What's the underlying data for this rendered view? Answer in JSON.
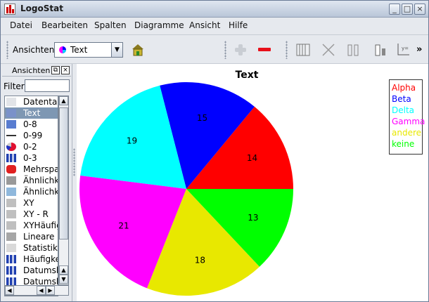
{
  "window": {
    "title": "LogoStat"
  },
  "menubar": [
    "Datei",
    "Bearbeiten",
    "Spalten",
    "Diagramme",
    "Ansicht",
    "Hilfe"
  ],
  "toolbar": {
    "views_label": "Ansichten",
    "view_selected": "Text",
    "more_label": "»"
  },
  "sidebar": {
    "title": "Ansichten",
    "filter_label": "Filter",
    "filter_value": "",
    "items": [
      {
        "label": "Datentabelle",
        "icon": "table-icon"
      },
      {
        "label": "Text",
        "icon": "text-chart-icon",
        "selected": true
      },
      {
        "label": "0-8",
        "icon": "horizontal-bar-icon"
      },
      {
        "label": "0-99",
        "icon": "slider-icon"
      },
      {
        "label": "0-2",
        "icon": "pie-icon"
      },
      {
        "label": "0-3",
        "icon": "bar-chart-icon"
      },
      {
        "label": "Mehrspalten",
        "icon": "stop-icon"
      },
      {
        "label": "Ähnlichkeit",
        "icon": "grid-icon"
      },
      {
        "label": "Ähnlichkeit",
        "icon": "dots-icon"
      },
      {
        "label": "XY",
        "icon": "scatter-icon"
      },
      {
        "label": "XY - R",
        "icon": "scatter-r-icon"
      },
      {
        "label": "XYHäufigkeit",
        "icon": "scatter-freq-icon"
      },
      {
        "label": "Lineare R",
        "icon": "line-icon"
      },
      {
        "label": "Statistiktabelle",
        "icon": "stats-icon"
      },
      {
        "label": "Häufigkeit",
        "icon": "freq-icon"
      },
      {
        "label": "Datumshäufigkeit",
        "icon": "date-bar-icon"
      },
      {
        "label": "Datumshäufigkeit",
        "icon": "date-bar-icon"
      }
    ]
  },
  "chart_data": {
    "type": "pie",
    "title": "Text",
    "slices": [
      {
        "name": "Alpha",
        "value": 14,
        "color": "#ff0000"
      },
      {
        "name": "Beta",
        "value": 15,
        "color": "#0000ff"
      },
      {
        "name": "Delta",
        "value": 19,
        "color": "#00ffff"
      },
      {
        "name": "Gamma",
        "value": 21,
        "color": "#ff00ff"
      },
      {
        "name": "andere",
        "value": 18,
        "color": "#e8e800"
      },
      {
        "name": "keine",
        "value": 13,
        "color": "#00ff00"
      }
    ],
    "start_angle_deg": 0,
    "direction": "counterclockwise",
    "legend_position": "top-right"
  }
}
